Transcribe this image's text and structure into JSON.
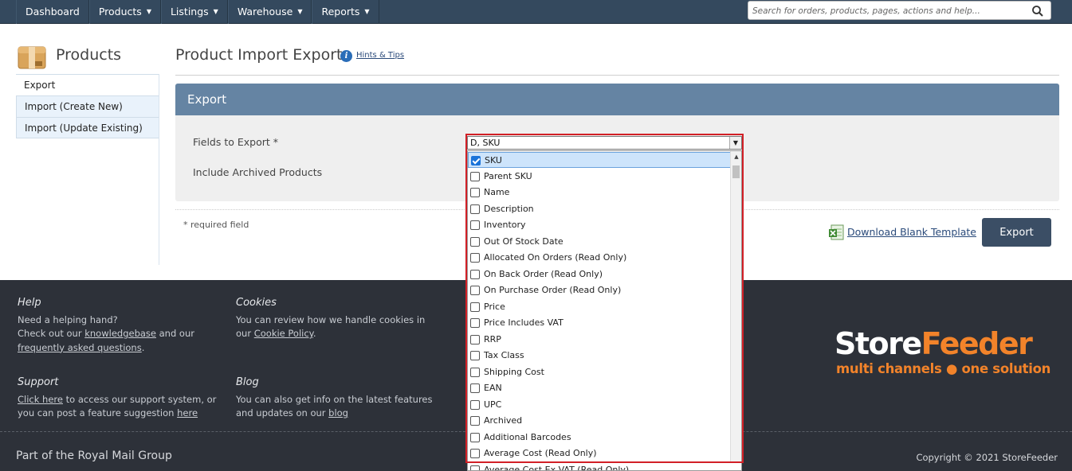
{
  "topnav": {
    "items": [
      {
        "label": "Dashboard",
        "has_menu": false
      },
      {
        "label": "Products",
        "has_menu": true
      },
      {
        "label": "Listings",
        "has_menu": true
      },
      {
        "label": "Warehouse",
        "has_menu": true
      },
      {
        "label": "Reports",
        "has_menu": true
      }
    ],
    "caret": "▼",
    "search_placeholder": "Search for orders, products, pages, actions and help..."
  },
  "sidebar": {
    "title": "Products",
    "items": [
      {
        "label": "Export",
        "active": true
      },
      {
        "label": "Import (Create New)",
        "active": false
      },
      {
        "label": "Import (Update Existing)",
        "active": false
      }
    ]
  },
  "main": {
    "title": "Product Import Export",
    "info_glyph": "i",
    "hints_label": "Hints & Tips",
    "panel_title": "Export",
    "fields_label": "Fields to Export *",
    "archived_label": "Include Archived Products",
    "required_note": "* required field",
    "download_label": "Download Blank Template",
    "export_button": "Export"
  },
  "fields_select": {
    "value": "D, SKU",
    "arrow": "▼",
    "scroll_up": "▲",
    "options": [
      {
        "label": "SKU",
        "checked": true
      },
      {
        "label": "Parent SKU",
        "checked": false
      },
      {
        "label": "Name",
        "checked": false
      },
      {
        "label": "Description",
        "checked": false
      },
      {
        "label": "Inventory",
        "checked": false
      },
      {
        "label": "Out Of Stock Date",
        "checked": false
      },
      {
        "label": "Allocated On Orders (Read Only)",
        "checked": false
      },
      {
        "label": "On Back Order (Read Only)",
        "checked": false
      },
      {
        "label": "On Purchase Order (Read Only)",
        "checked": false
      },
      {
        "label": "Price",
        "checked": false
      },
      {
        "label": "Price Includes VAT",
        "checked": false
      },
      {
        "label": "RRP",
        "checked": false
      },
      {
        "label": "Tax Class",
        "checked": false
      },
      {
        "label": "Shipping Cost",
        "checked": false
      },
      {
        "label": "EAN",
        "checked": false
      },
      {
        "label": "UPC",
        "checked": false
      },
      {
        "label": "Archived",
        "checked": false
      },
      {
        "label": "Additional Barcodes",
        "checked": false
      },
      {
        "label": "Average Cost (Read Only)",
        "checked": false
      },
      {
        "label": "Average Cost Ex VAT (Read Only)",
        "checked": false
      }
    ]
  },
  "footer": {
    "help": {
      "title": "Help",
      "line1": "Need a helping hand?",
      "line2_pre": "Check out our ",
      "line2_link": "knowledgebase",
      "line2_post": " and our",
      "line3_link": "frequently asked questions",
      "line3_post": "."
    },
    "cookies": {
      "title": "Cookies",
      "line1": "You can review how we handle cookies in",
      "line2_pre": "our ",
      "line2_link": "Cookie Policy",
      "line2_post": "."
    },
    "support": {
      "title": "Support",
      "line1_link": "Click here",
      "line1_post": " to access our support system, or",
      "line2_pre": "you can post a feature suggestion ",
      "line2_link": "here"
    },
    "blog": {
      "title": "Blog",
      "line1": "You can also get info on the latest features",
      "line2_pre": "and updates on our ",
      "line2_link": "blog"
    },
    "logo": {
      "word1a": "Store",
      "word1b": "Feeder",
      "tagline": "multi channels ● one solution"
    },
    "royal_mail": "Part of the Royal Mail Group",
    "copyright": "Copyright © 2021 StoreFeeder"
  },
  "colors": {
    "nav_bg": "#34495e",
    "panel_header": "#6584a3",
    "button_bg": "#3b4e65",
    "footer_bg": "#2d3139",
    "brand_orange": "#f2832a",
    "highlight_frame": "#d21f26",
    "checkbox_checked": "#1a73d9"
  }
}
